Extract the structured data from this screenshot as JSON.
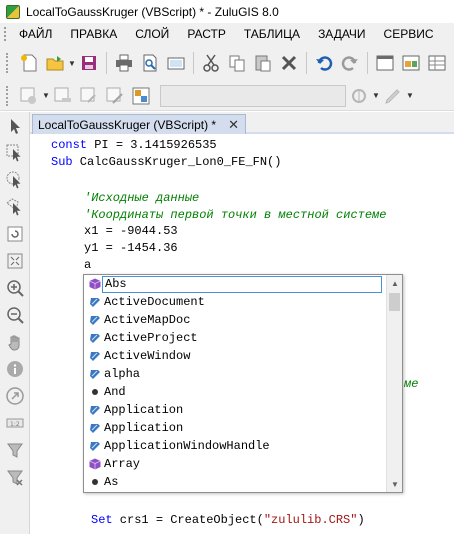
{
  "window": {
    "title": "LocalToGaussKruger (VBScript) * - ZuluGIS 8.0"
  },
  "menu": [
    "ФАЙЛ",
    "ПРАВКА",
    "СЛОЙ",
    "РАСТР",
    "ТАБЛИЦА",
    "ЗАДАЧИ",
    "СЕРВИС"
  ],
  "tab": {
    "label": "LocalToGaussKruger (VBScript) *",
    "close": "✕"
  },
  "code": {
    "l1_kw": "const",
    "l1_rest": " PI = 3.1415926535",
    "l2_kw": "Sub",
    "l2_rest": " CalcGaussKruger_Lon0_FE_FN()",
    "c1": "'Исходные данные",
    "c2": "'Координаты первой точки в местной системе",
    "x1": "x1 = -9044.53",
    "y1": "y1 = -1454.36",
    "typed": "a",
    "partial_comment": "ме",
    "last_kw": "Set",
    "last_mid": " crs1 = CreateObject(",
    "last_str": "\"zululib.CRS\"",
    "last_end": ")"
  },
  "autocomplete": {
    "items": [
      {
        "label": "Abs",
        "icon": "function"
      },
      {
        "label": "ActiveDocument",
        "icon": "property"
      },
      {
        "label": "ActiveMapDoc",
        "icon": "property"
      },
      {
        "label": "ActiveProject",
        "icon": "property"
      },
      {
        "label": "ActiveWindow",
        "icon": "property"
      },
      {
        "label": "alpha",
        "icon": "property"
      },
      {
        "label": "And",
        "icon": "keyword"
      },
      {
        "label": "Application",
        "icon": "property"
      },
      {
        "label": "Application",
        "icon": "property"
      },
      {
        "label": "ApplicationWindowHandle",
        "icon": "property"
      },
      {
        "label": "Array",
        "icon": "function"
      },
      {
        "label": "As",
        "icon": "keyword"
      }
    ],
    "selected_index": 0
  },
  "colors": {
    "keyword": "#0000ff",
    "comment": "#008000",
    "string": "#a31515",
    "function_icon": "#8e4fc4",
    "property_icon": "#3b78c4"
  }
}
